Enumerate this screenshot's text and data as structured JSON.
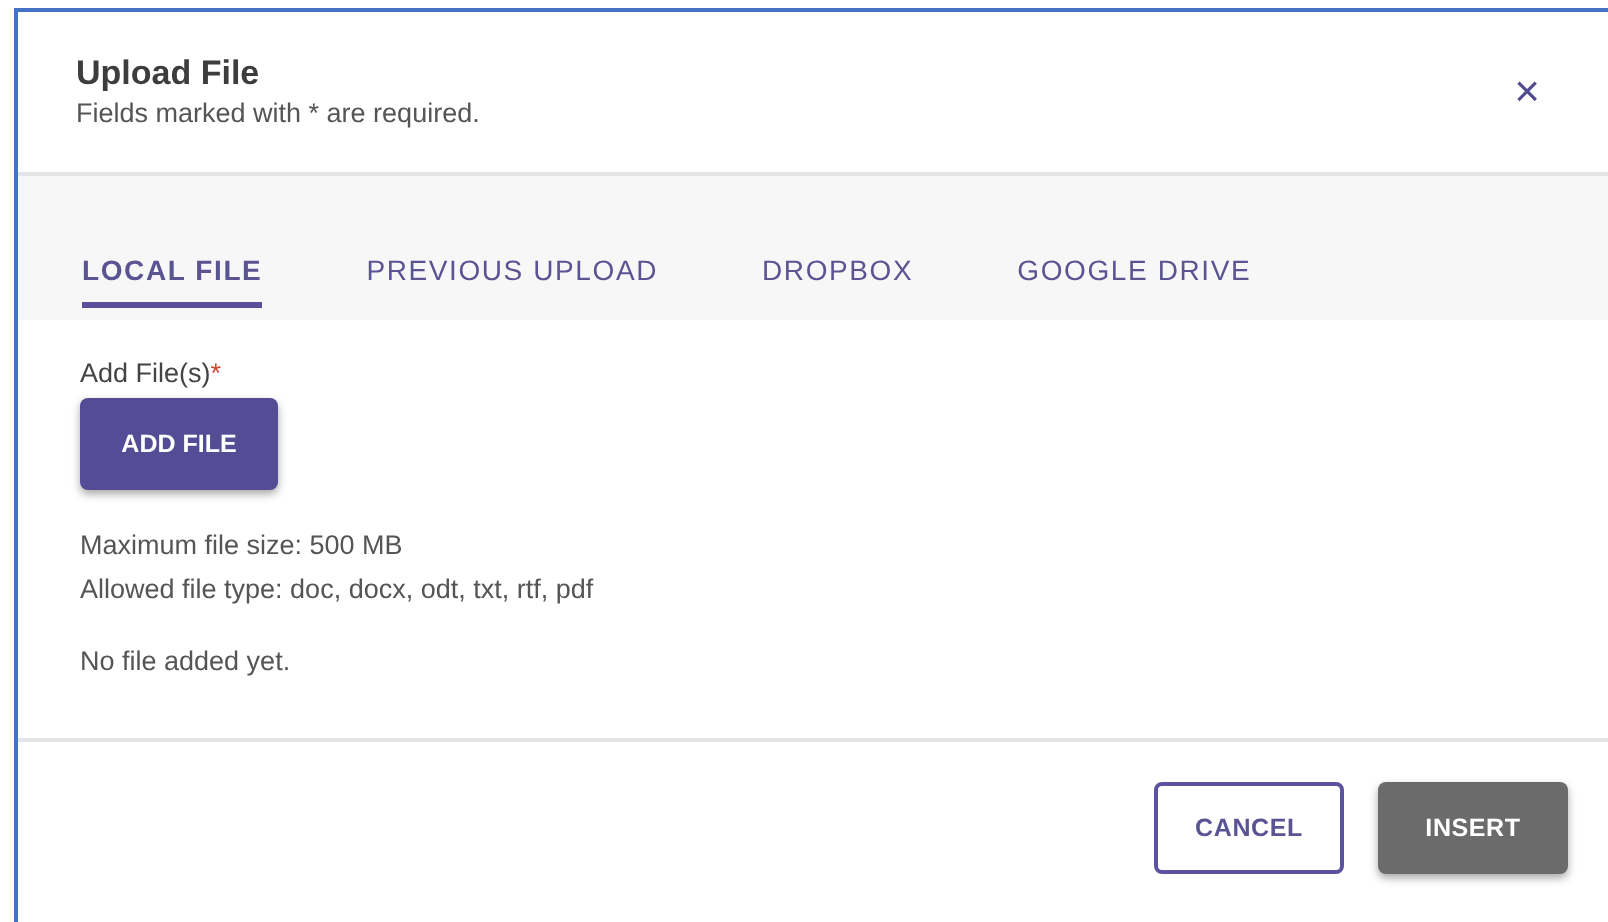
{
  "dialog": {
    "title": "Upload File",
    "subtitle": "Fields marked with * are required.",
    "close": "×"
  },
  "tabs": [
    {
      "label": "LOCAL FILE",
      "selected": true
    },
    {
      "label": "PREVIOUS UPLOAD",
      "selected": false
    },
    {
      "label": "DROPBOX",
      "selected": false
    },
    {
      "label": "GOOGLE DRIVE",
      "selected": false
    }
  ],
  "field": {
    "label": "Add File(s)",
    "required_mark": "*",
    "button": "ADD FILE"
  },
  "notes": [
    "Maximum file size: 500 MB",
    "Allowed file type: doc, docx, odt, txt, rtf, pdf"
  ],
  "status": "No file added yet.",
  "buttons": [
    {
      "label": "CANCEL",
      "kind": "outline",
      "disabled": false
    },
    {
      "label": "INSERT",
      "kind": "filled",
      "disabled": true
    }
  ]
}
